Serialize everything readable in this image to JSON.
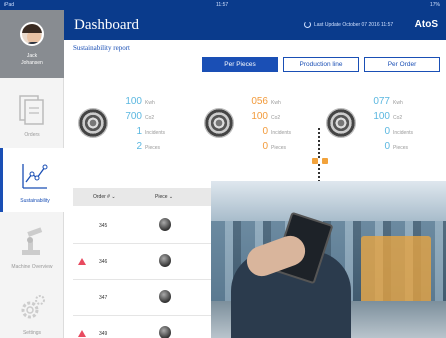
{
  "status_bar": {
    "left": "iPad",
    "time": "11:57",
    "right": "17%"
  },
  "profile": {
    "first_name": "Jack",
    "last_name": "Johansen"
  },
  "sidebar": {
    "items": [
      {
        "label": "Orders",
        "icon": "orders-icon"
      },
      {
        "label": "Sustainability",
        "icon": "chart-line-icon",
        "active": true
      },
      {
        "label": "Machine Overview",
        "icon": "robot-arm-icon"
      },
      {
        "label": "Settings",
        "icon": "gear-icon"
      }
    ]
  },
  "header": {
    "title": "Dashboard",
    "update_text": "Last Update October 07 2016 11:57",
    "logo": "AtoS"
  },
  "report": {
    "title": "Sustainability report",
    "tabs": [
      {
        "label": "Per Pieces",
        "active": true
      },
      {
        "label": "Production line",
        "active": false
      },
      {
        "label": "Per Order",
        "active": false
      }
    ]
  },
  "metrics": [
    {
      "kwh": "100",
      "co2": "700",
      "incidents": "1",
      "pieces": "2",
      "color": "#5bb7e0"
    },
    {
      "kwh": "056",
      "co2": "100",
      "incidents": "0",
      "pieces": "0",
      "color": "#f29b3c"
    },
    {
      "kwh": "077",
      "co2": "100",
      "incidents": "0",
      "pieces": "0",
      "color": "#5bb7e0"
    }
  ],
  "metric_units": {
    "kwh": "Kwh",
    "co2": "Co2",
    "incidents": "Incidents",
    "pieces": "Pieces"
  },
  "table": {
    "headers": {
      "order": "Order #",
      "piece": "Piece"
    },
    "rows": [
      {
        "order": "345",
        "warning": false
      },
      {
        "order": "346",
        "warning": true
      },
      {
        "order": "347",
        "warning": false
      },
      {
        "order": "349",
        "warning": true
      }
    ]
  },
  "colors": {
    "primary": "#0a3b8c",
    "accent": "#1a4fb5",
    "warning": "#e84a5f"
  }
}
